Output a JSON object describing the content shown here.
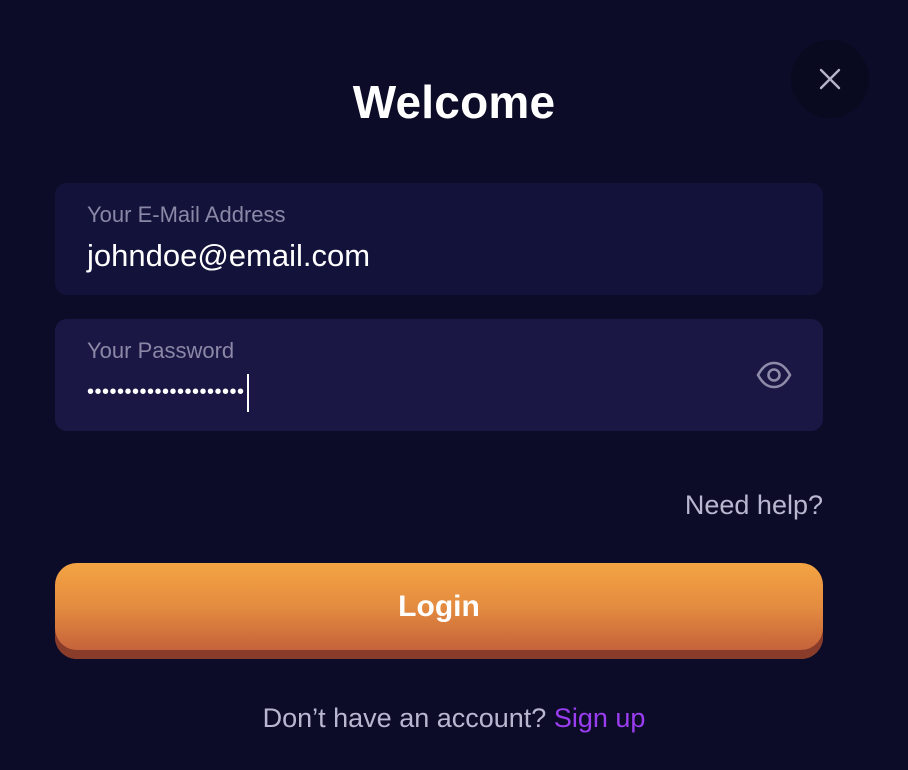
{
  "modal": {
    "title": "Welcome",
    "close_icon": "close-icon"
  },
  "email_field": {
    "label": "Your E-Mail Address",
    "value": "johndoe@email.com"
  },
  "password_field": {
    "label": "Your Password",
    "value": "•••••••••••••••••••••",
    "toggle_icon": "eye-icon"
  },
  "help": {
    "label": "Need help?"
  },
  "login": {
    "label": "Login"
  },
  "signup": {
    "prompt": "Don’t have an account?",
    "link": "Sign up"
  },
  "colors": {
    "background": "#0c0c29",
    "accent_orange": "#f4a443",
    "link_purple": "#9a3df0"
  }
}
